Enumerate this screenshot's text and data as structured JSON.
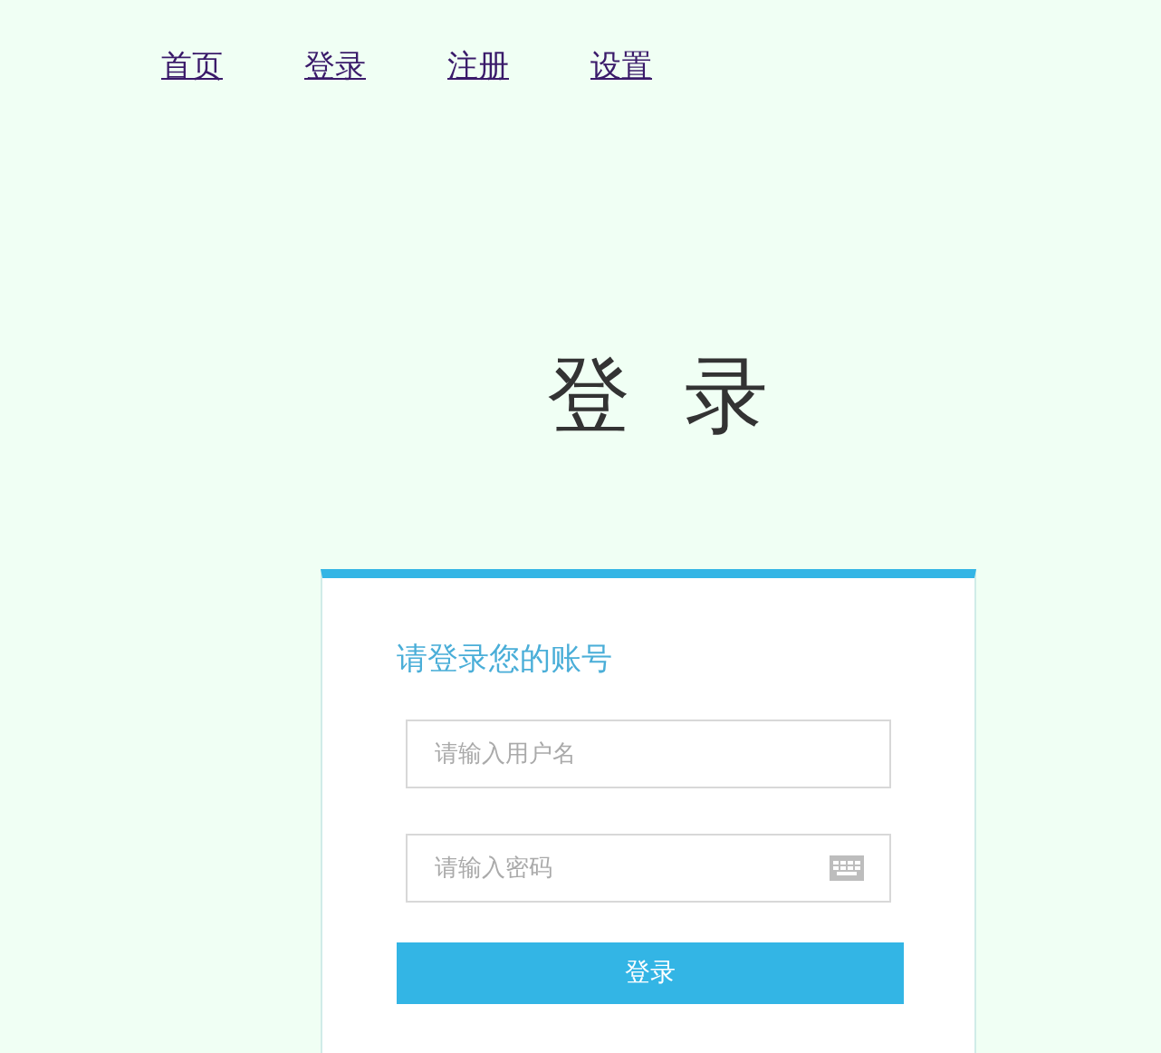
{
  "nav": [
    {
      "label": "首页"
    },
    {
      "label": "登录"
    },
    {
      "label": "注册"
    },
    {
      "label": "设置"
    }
  ],
  "heading": "登录",
  "card": {
    "title": "请登录您的账号",
    "fields": [
      {
        "kind": "text",
        "placeholder": "请输入用户名"
      },
      {
        "kind": "password",
        "placeholder": "请输入密码"
      }
    ],
    "submit": "登录"
  }
}
